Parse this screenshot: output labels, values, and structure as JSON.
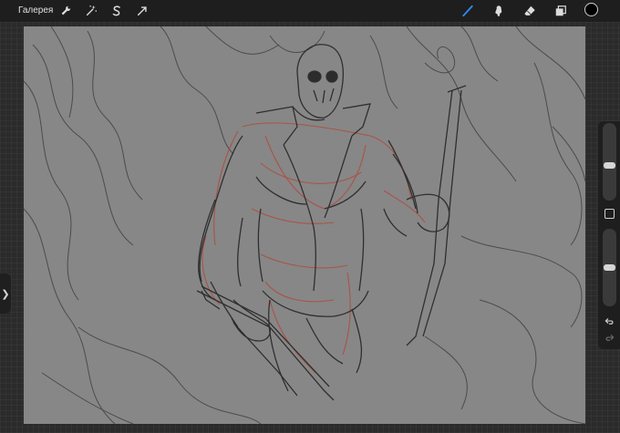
{
  "topbar": {
    "gallery_label": "Галерея",
    "left_tools": [
      {
        "name": "actions",
        "icon": "wrench-icon"
      },
      {
        "name": "adjustments",
        "icon": "magic-wand-icon"
      },
      {
        "name": "selection",
        "icon": "selection-s-icon"
      },
      {
        "name": "transform",
        "icon": "transform-arrow-icon"
      }
    ],
    "right_tools": [
      {
        "name": "brush",
        "icon": "brush-icon",
        "active": true
      },
      {
        "name": "smudge",
        "icon": "smudge-icon"
      },
      {
        "name": "eraser",
        "icon": "eraser-icon"
      },
      {
        "name": "layers",
        "icon": "layers-icon"
      }
    ],
    "current_color": "#000000",
    "active_tool_color": "#2f8cff"
  },
  "canvas": {
    "background_color": "#878787",
    "sketch_line_color": "#3a3a3a",
    "construction_line_color": "#b04a3c"
  },
  "side_panel": {
    "brush_size_level": 0.45,
    "opacity_level": 0.5
  }
}
